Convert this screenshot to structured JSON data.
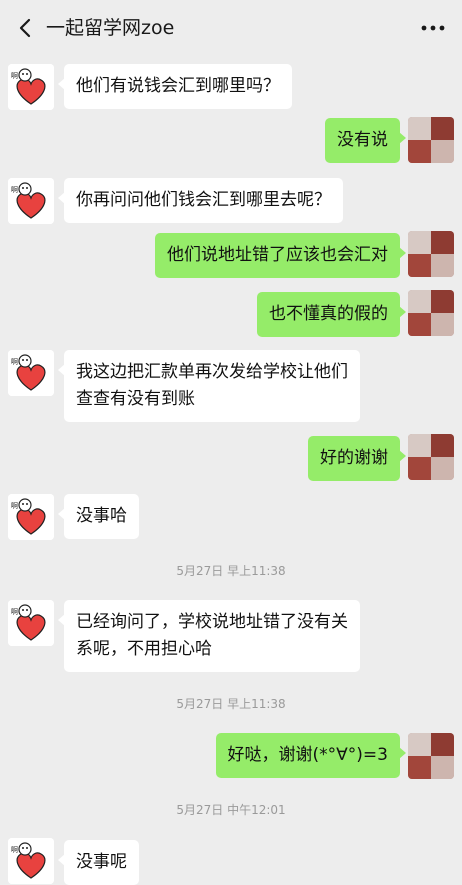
{
  "header": {
    "title": "一起留学网zoe",
    "back_icon": "chevron-left-icon",
    "more_icon": "more-dots-icon"
  },
  "messages": [
    {
      "side": "left",
      "text": "他们有说钱会汇到哪里吗？"
    },
    {
      "side": "right",
      "text": "没有说"
    },
    {
      "side": "left",
      "text": "你再问问他们钱会汇到哪里去呢？"
    },
    {
      "side": "right",
      "text": "他们说地址错了应该也会汇对"
    },
    {
      "side": "right",
      "text": "也不懂真的假的"
    },
    {
      "side": "left",
      "text": "我这边把汇款单再次发给学校让他们\n查查有没有到账"
    },
    {
      "side": "right",
      "text": "好的谢谢"
    },
    {
      "side": "left",
      "text": "没事哈"
    },
    {
      "side": "left",
      "text": "已经询问了，学校说地址错了没有关\n系呢，不用担心哈"
    },
    {
      "side": "right",
      "text": "好哒，谢谢(*°∀°)=3"
    },
    {
      "side": "left",
      "text": "没事呢"
    }
  ],
  "timestamps": [
    "5月27日 早上11:38",
    "5月27日 早上11:38",
    "5月27日 中午12:01"
  ],
  "colors": {
    "background": "#ededed",
    "bubble_left": "#ffffff",
    "bubble_right": "#95ec69"
  },
  "avatar_left_icon": "heart-bear-avatar-icon",
  "avatar_right_icon": "blurred-avatar-icon"
}
